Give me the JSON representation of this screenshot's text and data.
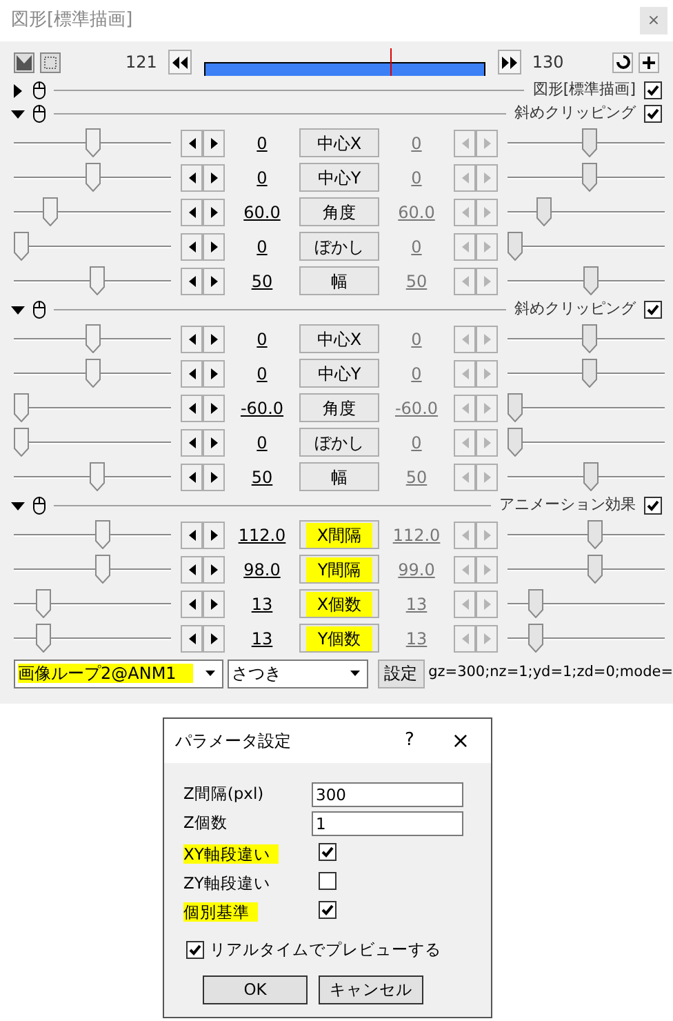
{
  "window": {
    "title": "図形[標準描画]",
    "close": "×"
  },
  "timeline": {
    "start": "121",
    "end": "130",
    "level": 0.67
  },
  "sections": [
    {
      "title": "図形[標準描画]",
      "expanded": false,
      "checked": true
    },
    {
      "title": "斜めクリッピング",
      "expanded": true,
      "checked": true,
      "params": [
        {
          "name": "中心X",
          "highlighted": false,
          "start": {
            "value": "0",
            "level": 0.5
          },
          "end": {
            "value": "0",
            "level": 0.52
          }
        },
        {
          "name": "中心Y",
          "highlighted": false,
          "start": {
            "value": "0",
            "level": 0.5
          },
          "end": {
            "value": "0",
            "level": 0.52
          }
        },
        {
          "name": "角度",
          "highlighted": false,
          "start": {
            "value": "60.0",
            "level": 0.2
          },
          "end": {
            "value": "60.0",
            "level": 0.2
          }
        },
        {
          "name": "ぼかし",
          "highlighted": false,
          "start": {
            "value": "0",
            "level": 0
          },
          "end": {
            "value": "0",
            "level": 0
          }
        },
        {
          "name": "幅",
          "highlighted": false,
          "start": {
            "value": "50",
            "level": 0.53
          },
          "end": {
            "value": "50",
            "level": 0.53
          }
        }
      ]
    },
    {
      "title": "斜めクリッピング",
      "expanded": true,
      "checked": true,
      "params": [
        {
          "name": "中心X",
          "highlighted": false,
          "start": {
            "value": "0",
            "level": 0.5
          },
          "end": {
            "value": "0",
            "level": 0.52
          }
        },
        {
          "name": "中心Y",
          "highlighted": false,
          "start": {
            "value": "0",
            "level": 0.5
          },
          "end": {
            "value": "0",
            "level": 0.52
          }
        },
        {
          "name": "角度",
          "highlighted": false,
          "start": {
            "value": "-60.0",
            "level": 0
          },
          "end": {
            "value": "-60.0",
            "level": 0
          }
        },
        {
          "name": "ぼかし",
          "highlighted": false,
          "start": {
            "value": "0",
            "level": 0
          },
          "end": {
            "value": "0",
            "level": 0
          }
        },
        {
          "name": "幅",
          "highlighted": false,
          "start": {
            "value": "50",
            "level": 0.53
          },
          "end": {
            "value": "50",
            "level": 0.53
          }
        }
      ]
    },
    {
      "title": "アニメーション効果",
      "expanded": true,
      "checked": true,
      "params": [
        {
          "name": "X間隔",
          "highlighted": true,
          "start": {
            "value": "112.0",
            "level": 0.57
          },
          "end": {
            "value": "112.0",
            "level": 0.56
          }
        },
        {
          "name": "Y間隔",
          "highlighted": true,
          "start": {
            "value": "98.0",
            "level": 0.57
          },
          "end": {
            "value": "99.0",
            "level": 0.56
          }
        },
        {
          "name": "X個数",
          "highlighted": true,
          "start": {
            "value": "13",
            "level": 0.16
          },
          "end": {
            "value": "13",
            "level": 0.15
          }
        },
        {
          "name": "Y個数",
          "highlighted": true,
          "start": {
            "value": "13",
            "level": 0.16
          },
          "end": {
            "value": "13",
            "level": 0.15
          }
        }
      ]
    }
  ],
  "bottom": {
    "script": {
      "value": "画像ループ2@ANM1",
      "highlighted": true
    },
    "target": {
      "value": "さつき",
      "highlighted": false
    },
    "settings_button": "設定",
    "params_text": "gz=300;nz=1;yd=1;zd=0;mode="
  },
  "dialog": {
    "title": "パラメータ設定",
    "help": "?",
    "close": "×",
    "fields": [
      {
        "label": "Z間隔(pxl)",
        "value": "300"
      },
      {
        "label": "Z個数",
        "value": "1"
      }
    ],
    "checks": [
      {
        "label": "XY軸段違い",
        "checked": true,
        "highlighted": true
      },
      {
        "label": "ZY軸段違い",
        "checked": false,
        "highlighted": false
      },
      {
        "label": "個別基準",
        "checked": true,
        "highlighted": true
      }
    ],
    "preview": {
      "label": "リアルタイムでプレビューする",
      "checked": true
    },
    "buttons": [
      "OK",
      "キャンセル"
    ]
  }
}
